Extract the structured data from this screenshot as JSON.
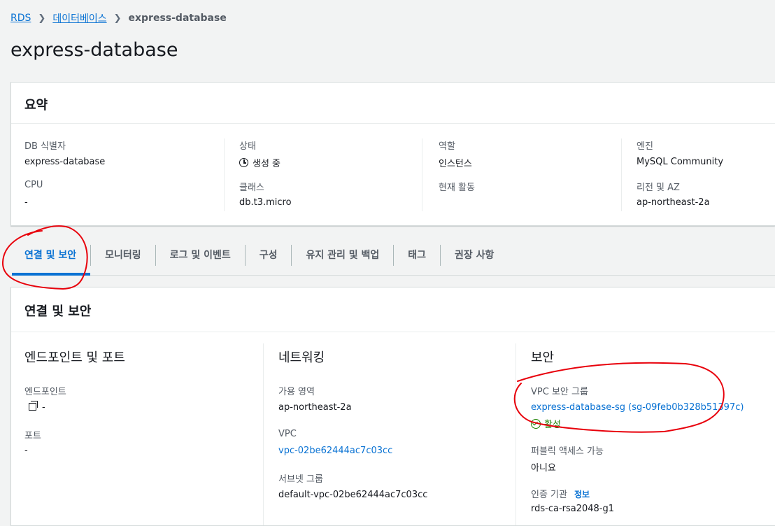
{
  "breadcrumb": {
    "items": [
      "RDS",
      "데이터베이스"
    ],
    "current": "express-database"
  },
  "page": {
    "title": "express-database"
  },
  "summary": {
    "title": "요약",
    "db_id_label": "DB 식별자",
    "db_id": "express-database",
    "cpu_label": "CPU",
    "cpu": "-",
    "status_label": "상태",
    "status": "생성 중",
    "class_label": "클래스",
    "class": "db.t3.micro",
    "role_label": "역할",
    "role": "인스턴스",
    "activity_label": "현재 활동",
    "engine_label": "엔진",
    "engine": "MySQL Community",
    "region_label": "리전 및 AZ",
    "region": "ap-northeast-2a"
  },
  "tabs": [
    "연결 및 보안",
    "모니터링",
    "로그 및 이벤트",
    "구성",
    "유지 관리 및 백업",
    "태그",
    "권장 사항"
  ],
  "active_tab": 0,
  "connectivity": {
    "title": "연결 및 보안",
    "endpoint_section": {
      "title": "엔드포인트 및 포트",
      "endpoint_label": "엔드포인트",
      "endpoint": "-",
      "port_label": "포트",
      "port": "-"
    },
    "network_section": {
      "title": "네트워킹",
      "az_label": "가용 영역",
      "az": "ap-northeast-2a",
      "vpc_label": "VPC",
      "vpc": "vpc-02be62444ac7c03cc",
      "subnet_label": "서브넷 그룹",
      "subnet": "default-vpc-02be62444ac7c03cc"
    },
    "security_section": {
      "title": "보안",
      "sg_label": "VPC 보안 그룹",
      "sg": "express-database-sg (sg-09feb0b328b51397c)",
      "sg_status": "활성",
      "public_label": "퍼블릭 액세스 가능",
      "public": "아니요",
      "ca_label": "인증 기관",
      "ca_info": "정보",
      "ca": "rds-ca-rsa2048-g1"
    }
  },
  "colors": {
    "link": "#0972d3",
    "success": "#1d8102",
    "annotation": "#e8000b"
  }
}
